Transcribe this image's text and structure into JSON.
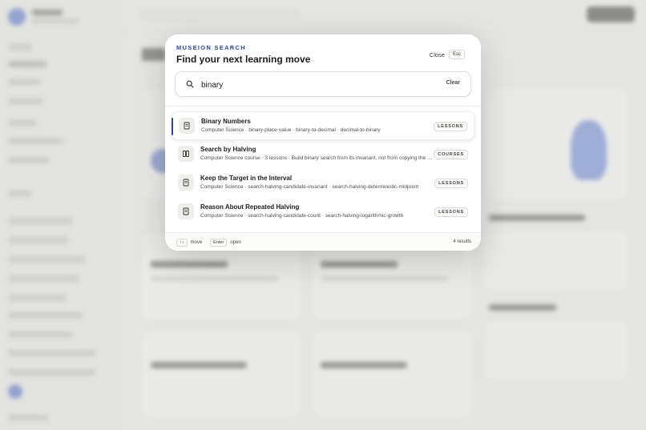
{
  "modal": {
    "eyebrow": "MUSEION SEARCH",
    "title": "Find your next learning move",
    "close_label": "Close",
    "close_key": "Esc"
  },
  "search": {
    "query": "binary",
    "clear_label": "Clear"
  },
  "results": [
    {
      "title": "Binary Numbers",
      "subtitle": "Computer Science · binary-place-value · binary-to-decimal · decimal-to-binary",
      "badge": "LESSONS",
      "icon": "lesson-icon"
    },
    {
      "title": "Search by Halving",
      "subtitle": "Computer Science course · 3 lessons · Build binary search from its invariant, not from copying the code",
      "badge": "COURSES",
      "icon": "course-icon"
    },
    {
      "title": "Keep the Target in the Interval",
      "subtitle": "Computer Science · search-halving-candidate-invariant · search-halving-deterministic-midpoint",
      "badge": "LESSONS",
      "icon": "lesson-icon"
    },
    {
      "title": "Reason About Repeated Halving",
      "subtitle": "Computer Science · search-halving-candidate-count · search-halving-logarithmic-growth",
      "badge": "LESSONS",
      "icon": "lesson-icon"
    }
  ],
  "footer": {
    "move_key": "↑↓",
    "move_label": "move",
    "open_key": "Enter",
    "open_label": "open",
    "result_count": "4 results"
  },
  "colors": {
    "accent": "#2a4aa8",
    "background": "#f4f4f2"
  }
}
